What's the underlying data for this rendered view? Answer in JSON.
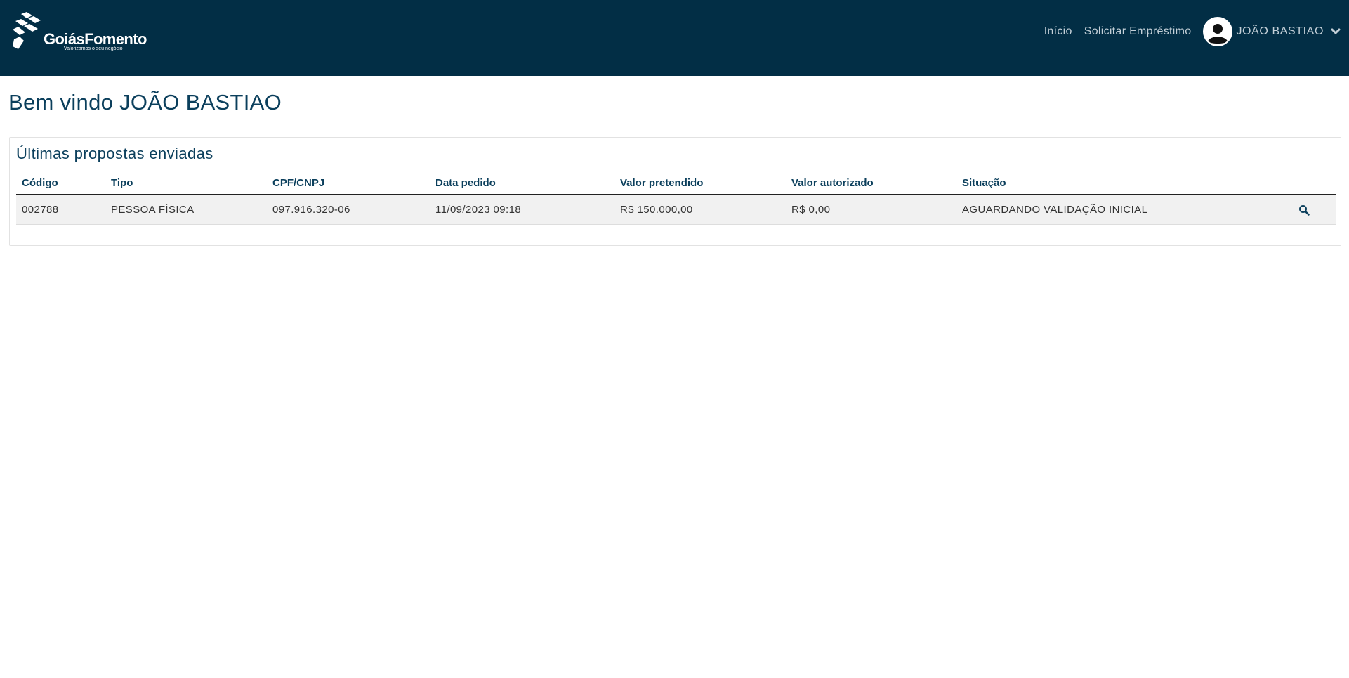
{
  "header": {
    "logo": {
      "name": "GoiásFomento",
      "slogan": "Valorizamos o seu negócio"
    },
    "nav": [
      {
        "label": "Início"
      },
      {
        "label": "Solicitar Empréstimo"
      }
    ],
    "user": {
      "name": "JOÃO BASTIAO",
      "avatar_icon": "user-avatar-icon",
      "dropdown_icon": "chevron-down-icon"
    }
  },
  "welcome": {
    "text": "Bem vindo JOÃO BASTIAO"
  },
  "proposals": {
    "title": "Últimas propostas enviadas",
    "columns": [
      "Código",
      "Tipo",
      "CPF/CNPJ",
      "Data pedido",
      "Valor pretendido",
      "Valor autorizado",
      "Situação"
    ],
    "rows": [
      {
        "codigo": "002788",
        "tipo": "PESSOA FÍSICA",
        "cpf_cnpj": "097.916.320-06",
        "data_pedido": "11/09/2023 09:18",
        "valor_pretendido": "R$ 150.000,00",
        "valor_autorizado": "R$ 0,00",
        "situacao": "AGUARDANDO VALIDAÇÃO INICIAL",
        "action_icon": "search-icon"
      }
    ]
  },
  "colors": {
    "header_bg": "#022e45",
    "accent_text": "#0b3f5c",
    "row_bg": "#f1f1f1"
  }
}
